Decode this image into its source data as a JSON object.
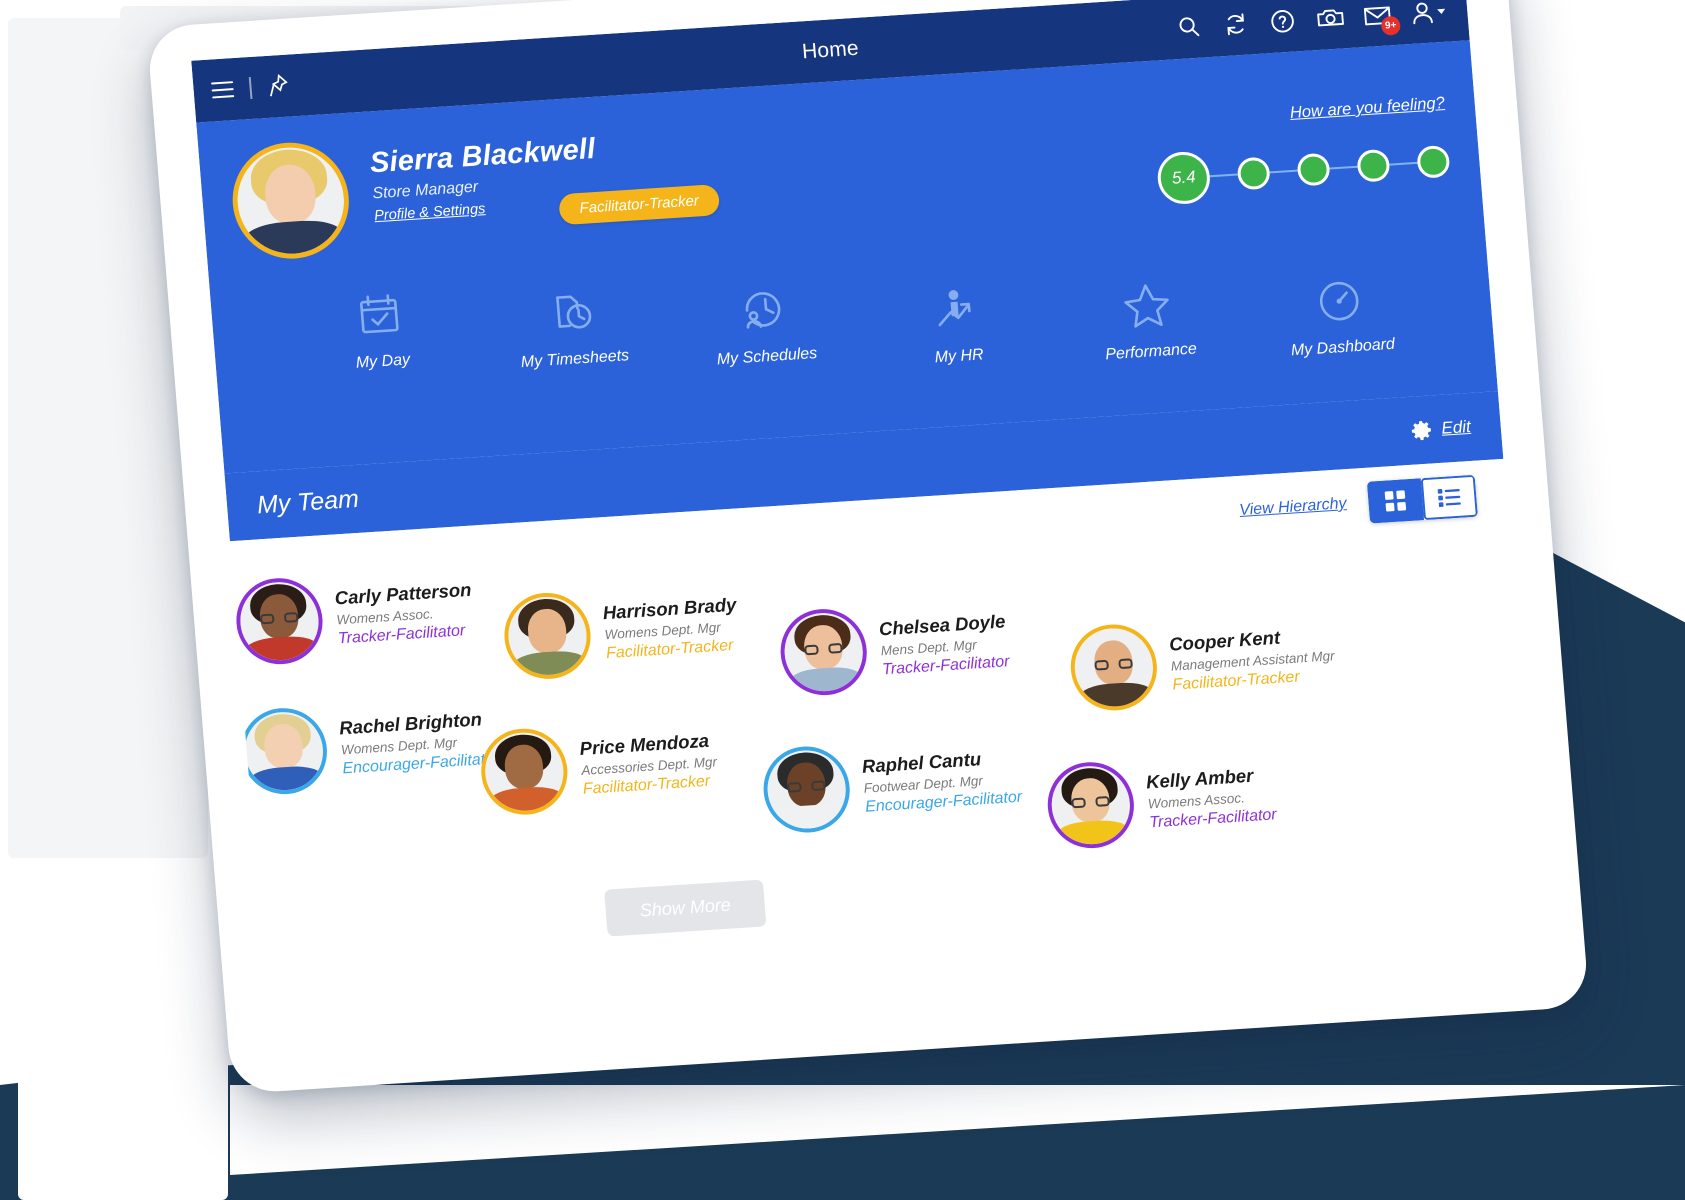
{
  "topbar": {
    "menu_icon": "hamburger-menu-icon",
    "pin_icon": "pin-icon",
    "title": "Home",
    "icons": [
      {
        "name": "search-icon",
        "label": "Search"
      },
      {
        "name": "refresh-icon",
        "label": "Refresh"
      },
      {
        "name": "help-icon",
        "label": "Help"
      },
      {
        "name": "camera-icon",
        "label": "Camera"
      },
      {
        "name": "mail-icon",
        "label": "Mail",
        "badge": "9+"
      },
      {
        "name": "user-account-icon",
        "label": "Account"
      }
    ]
  },
  "profile": {
    "name": "Sierra Blackwell",
    "title": "Store Manager",
    "settings_link": "Profile & Settings",
    "role_badge": "Facilitator-Tracker",
    "avatar_icon": "user-avatar"
  },
  "feeling": {
    "link": "How are you feeling?",
    "score": "5.4",
    "dot_color": "#3cb44a",
    "dots": 5
  },
  "nav": {
    "items": [
      {
        "label": "My Day",
        "icon": "calendar-check-icon"
      },
      {
        "label": "My Timesheets",
        "icon": "timesheet-clock-icon"
      },
      {
        "label": "My Schedules",
        "icon": "person-clock-icon"
      },
      {
        "label": "My HR",
        "icon": "person-growth-arrow-icon"
      },
      {
        "label": "Performance",
        "icon": "star-icon"
      },
      {
        "label": "My Dashboard",
        "icon": "gauge-icon"
      }
    ]
  },
  "team": {
    "title": "My Team",
    "edit_label": "Edit",
    "edit_icon": "gear-icon",
    "view_hierarchy": "View Hierarchy",
    "grid_view_icon": "grid-view-icon",
    "list_view_icon": "list-view-icon",
    "active_view": "list",
    "show_more": "Show More",
    "role_colors": {
      "Tracker-Facilitator": "#8e30d8",
      "Facilitator-Tracker": "#f5b51a",
      "Encourager-Facilitator": "#3aa7e8"
    },
    "members": [
      {
        "name": "Carly Patterson",
        "dept": "Womens Assoc.",
        "role": "Tracker-Facilitator",
        "ring": "#8e30d8"
      },
      {
        "name": "Harrison Brady",
        "dept": "Womens Dept. Mgr",
        "role": "Facilitator-Tracker",
        "ring": "#f5b51a"
      },
      {
        "name": "Chelsea Doyle",
        "dept": "Mens Dept. Mgr",
        "role": "Tracker-Facilitator",
        "ring": "#8e30d8"
      },
      {
        "name": "Cooper Kent",
        "dept": "Management Assistant Mgr",
        "role": "Facilitator-Tracker",
        "ring": "#f5b51a"
      },
      {
        "name": "Rachel Brighton",
        "dept": "Womens Dept. Mgr",
        "role": "Encourager-Facilitator",
        "ring": "#3aa7e8"
      },
      {
        "name": "Price Mendoza",
        "dept": "Accessories Dept. Mgr",
        "role": "Facilitator-Tracker",
        "ring": "#f5b51a"
      },
      {
        "name": "Raphel Cantu",
        "dept": "Footwear Dept. Mgr",
        "role": "Encourager-Facilitator",
        "ring": "#3aa7e8"
      },
      {
        "name": "Kelly Amber",
        "dept": "Womens Assoc.",
        "role": "Tracker-Facilitator",
        "ring": "#8e30d8"
      }
    ]
  },
  "colors": {
    "topbar": "#15357e",
    "hero": "#2b62d9",
    "accent_yellow": "#f5b51a",
    "background_navy": "#1b3a56"
  }
}
